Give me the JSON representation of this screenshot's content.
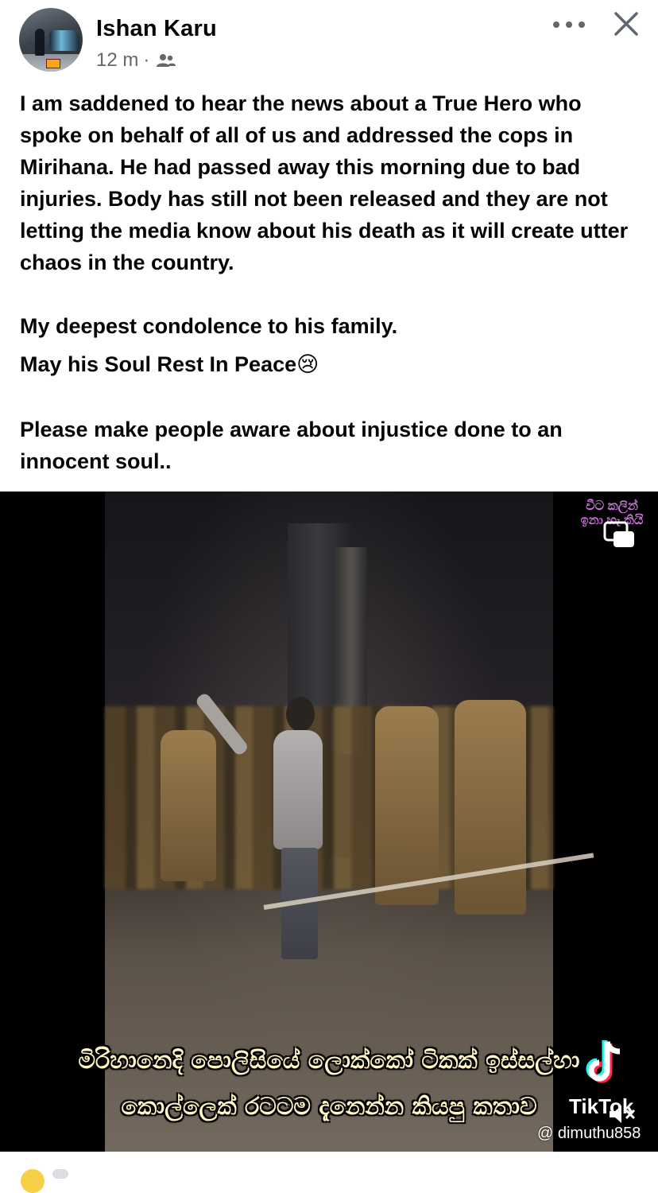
{
  "post": {
    "author": "Ishan Karu",
    "time": "12 m",
    "separator": "·",
    "audience_icon": "friends-icon",
    "text_paragraphs": [
      "I am saddened to hear the news about a True Hero who spoke on behalf of all of us and addressed the cops in Mirihana. He had passed away this morning due to bad injuries. Body has still not been released and they are not letting the media know about his death as it will create utter chaos in the country.",
      "My deepest condolence to his family.",
      "May his Soul Rest In Peace😢",
      "Please make people aware about injustice done to an innocent soul.."
    ]
  },
  "video": {
    "watermark_text": "වීට කලින් ඉනා හැ කියි",
    "subtitle_line1": "මිරිහානෙදි පොලිසියේ ලොක්කෝ ටිකක් ඉස්සල්හා",
    "subtitle_line2": "කොල්ලෙක් රටටම දැනෙන්න කියපු කතාව",
    "platform": "TikTok",
    "handle": "@ dimuthu858"
  },
  "icons": {
    "more": "more-options-icon",
    "close": "close-icon",
    "pip": "picture-in-picture-icon",
    "mute": "muted-speaker-icon"
  },
  "colors": {
    "text": "#050505",
    "secondary_text": "#65676b",
    "subtitle": "#fff7c4",
    "watermark": "#c873d9"
  }
}
